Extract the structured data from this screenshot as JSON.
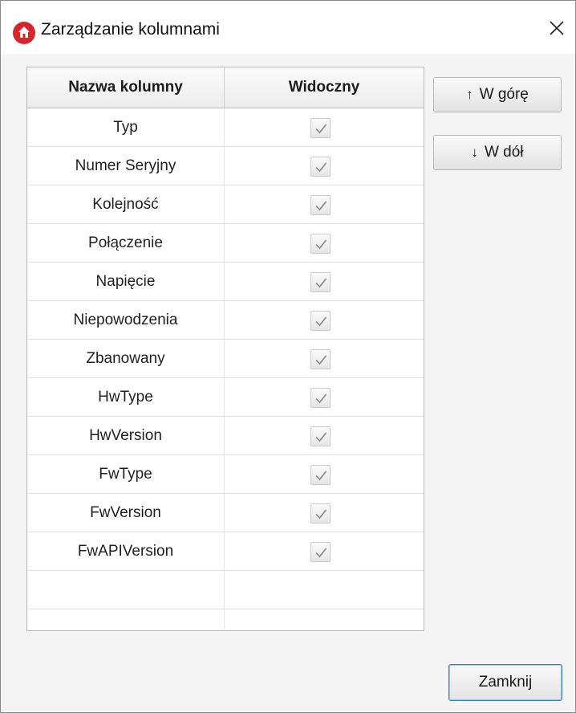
{
  "window": {
    "title": "Zarządzanie kolumnami",
    "icon": "home-icon",
    "close_icon": "close-icon"
  },
  "table": {
    "headers": [
      "Nazwa kolumny",
      "Widoczny"
    ],
    "rows": [
      {
        "name": "Typ",
        "visible": true
      },
      {
        "name": "Numer Seryjny",
        "visible": true
      },
      {
        "name": "Kolejność",
        "visible": true
      },
      {
        "name": "Połączenie",
        "visible": true
      },
      {
        "name": "Napięcie",
        "visible": true
      },
      {
        "name": "Niepowodzenia",
        "visible": true
      },
      {
        "name": "Zbanowany",
        "visible": true
      },
      {
        "name": "HwType",
        "visible": true
      },
      {
        "name": "HwVersion",
        "visible": true
      },
      {
        "name": "FwType",
        "visible": true
      },
      {
        "name": "FwVersion",
        "visible": true
      },
      {
        "name": "FwAPIVersion",
        "visible": true
      }
    ]
  },
  "buttons": {
    "up_label": "W górę",
    "up_arrow": "↑",
    "down_label": "W dół",
    "down_arrow": "↓",
    "close_label": "Zamknij"
  },
  "colors": {
    "accent": "#3b7ad0",
    "icon_red": "#d7262b"
  }
}
